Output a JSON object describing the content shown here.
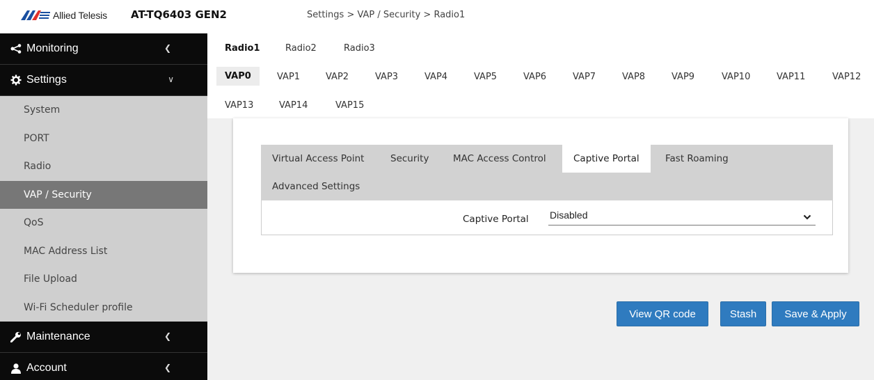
{
  "header": {
    "brand": "Allied Telesis",
    "model": "AT-TQ6403 GEN2",
    "breadcrumb": "Settings > VAP / Security > Radio1"
  },
  "sidebar": {
    "monitoring": {
      "label": "Monitoring",
      "icon": "share-icon"
    },
    "settings": {
      "label": "Settings",
      "icon": "gear-icon"
    },
    "sub_items": [
      "System",
      "PORT",
      "Radio",
      "VAP / Security",
      "QoS",
      "MAC Address List",
      "File Upload",
      "Wi-Fi Scheduler profile"
    ],
    "active_sub": "VAP / Security",
    "maintenance": {
      "label": "Maintenance",
      "icon": "wrench-icon"
    },
    "account": {
      "label": "Account",
      "icon": "user-icon"
    }
  },
  "radio_tabs": [
    "Radio1",
    "Radio2",
    "Radio3"
  ],
  "active_radio": "Radio1",
  "vap_tabs": [
    "VAP0",
    "VAP1",
    "VAP2",
    "VAP3",
    "VAP4",
    "VAP5",
    "VAP6",
    "VAP7",
    "VAP8",
    "VAP9",
    "VAP10",
    "VAP11",
    "VAP12",
    "VAP13",
    "VAP14",
    "VAP15"
  ],
  "active_vap": "VAP0",
  "inner_tabs": [
    "Virtual Access Point",
    "Security",
    "MAC Access Control",
    "Captive Portal",
    "Fast Roaming",
    "Advanced Settings"
  ],
  "active_inner_tab": "Captive Portal",
  "form": {
    "captive_portal_label": "Captive Portal",
    "captive_portal_value": "Disabled"
  },
  "buttons": {
    "view_qr": "View QR code",
    "stash": "Stash",
    "save_apply": "Save & Apply"
  },
  "colors": {
    "sidebar_dark": "#0b0b0b",
    "sidebar_light": "#cfcfcf",
    "sidebar_active": "#777777",
    "button_blue": "#2f7bbf",
    "brand_blue": "#1a4fa0",
    "brand_red": "#e0312b"
  }
}
